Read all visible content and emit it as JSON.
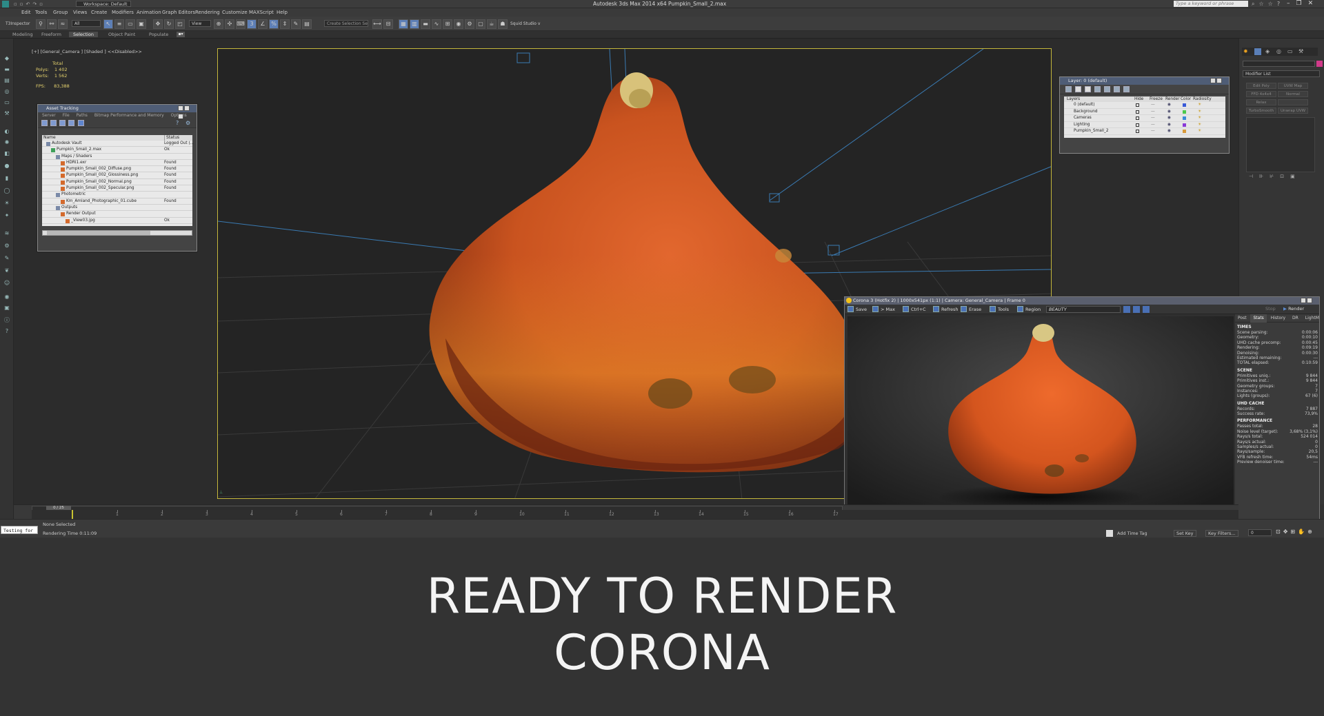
{
  "app": {
    "title": "Autodesk 3ds Max  2014 x64    Pumpkin_Small_2.max",
    "workspace": "Workspace: Default",
    "search_placeholder": "Type a keyword or phrase"
  },
  "menu": [
    "Edit",
    "Tools",
    "Group",
    "Views",
    "Create",
    "Modifiers",
    "Animation",
    "Graph Editors",
    "Rendering",
    "Customize",
    "MAXScript",
    "Help"
  ],
  "toolbar": {
    "left_label": "T3Inspector",
    "filter_value": "All",
    "view_value": "View",
    "selection_set": "Create Selection Se",
    "squid": "Squid Studio v"
  },
  "ribbon": {
    "tabs": [
      "Modeling",
      "Freeform",
      "Selection",
      "Object Paint",
      "Populate"
    ]
  },
  "viewport": {
    "label": "[+] [General_Camera ] [Shaded ] <<Disabled>>",
    "stats": {
      "total": "Total",
      "polys_label": "Polys:",
      "polys": "1 402",
      "verts_label": "Verts:",
      "verts": "1 562",
      "fps_label": "FPS:",
      "fps": "83,388"
    }
  },
  "asset_tracking": {
    "title": "Asset Tracking",
    "menu": [
      "Server",
      "File",
      "Paths",
      "Bitmap Performance and Memory",
      "Options"
    ],
    "headers": [
      "Name",
      "Status"
    ],
    "rows": [
      {
        "name": "Autodesk Vault",
        "status": "Logged Out (...",
        "indent": 0
      },
      {
        "name": "Pumpkin_Small_2.max",
        "status": "Ok",
        "indent": 1
      },
      {
        "name": "Maps / Shaders",
        "status": "",
        "indent": 2
      },
      {
        "name": "HDRI1.exr",
        "status": "Found",
        "indent": 3
      },
      {
        "name": "Pumpkin_Small_002_Diffuse.png",
        "status": "Found",
        "indent": 3
      },
      {
        "name": "Pumpkin_Small_002_Glossiness.png",
        "status": "Found",
        "indent": 3
      },
      {
        "name": "Pumpkin_Small_002_Normal.png",
        "status": "Found",
        "indent": 3
      },
      {
        "name": "Pumpkin_Small_002_Specular.png",
        "status": "Found",
        "indent": 3
      },
      {
        "name": "Photometric",
        "status": "",
        "indent": 2
      },
      {
        "name": "Km_Amland_Photographic_01.cube",
        "status": "Found",
        "indent": 3
      },
      {
        "name": "Outputs",
        "status": "",
        "indent": 2
      },
      {
        "name": "Render Output",
        "status": "",
        "indent": 3
      },
      {
        "name": "_View03.jpg",
        "status": "Ok",
        "indent": 4
      }
    ]
  },
  "layers": {
    "title": "Layer: 0 (default)",
    "headers": [
      "Layers",
      "Hide",
      "Freeze",
      "Render",
      "Color",
      "Radiosity"
    ],
    "rows": [
      {
        "name": "0 (default)",
        "color": "#3a5ad8"
      },
      {
        "name": "Background",
        "color": "#4cc94c"
      },
      {
        "name": "Cameras",
        "color": "#3a8ad8"
      },
      {
        "name": "Lighting",
        "color": "#8a3ad8"
      },
      {
        "name": "Pumpkin_Small_2",
        "color": "#d89a3a"
      }
    ]
  },
  "command_panel": {
    "modifier_list": "Modifier List",
    "buttons": [
      "Edit Poly",
      "UVW Map",
      "FFD 4x4x4",
      "Normal",
      "Relax",
      "",
      "TurboSmooth",
      "Unwrap UVW"
    ]
  },
  "corona": {
    "title": "Corona 3 (Hotfix 2) | 1000x541px (1:1) | Camera: General_Camera | Frame 0",
    "toolbar": [
      "Save",
      "> Max",
      "Ctrl+C",
      "Refresh",
      "Erase",
      "Tools",
      "Region"
    ],
    "pass": "BEAUTY",
    "stop": "Stop",
    "render": "Render",
    "tabs": [
      "Post",
      "Stats",
      "History",
      "DR",
      "LightMix"
    ],
    "sections": [
      {
        "title": "TIMES",
        "rows": [
          [
            "Scene parsing:",
            "0:00:06"
          ],
          [
            "Geometry:",
            "0:00:10"
          ],
          [
            "UHD cache precomp:",
            "0:00:45"
          ],
          [
            "Rendering:",
            "0:09:19"
          ],
          [
            "Denoising:",
            "0:00:30"
          ],
          [
            "Estimated remaining:",
            "---"
          ],
          [
            "TOTAL elapsed:",
            "0:10:59"
          ]
        ]
      },
      {
        "title": "SCENE",
        "rows": [
          [
            "Primitives uniq.:",
            "9 844"
          ],
          [
            "Primitives inst.:",
            "9 844"
          ],
          [
            "Geometry groups:",
            "7"
          ],
          [
            "Instances:",
            "7"
          ],
          [
            "Lights (groups):",
            "67 (6)"
          ]
        ]
      },
      {
        "title": "UHD CACHE",
        "rows": [
          [
            "Records:",
            "7 887"
          ],
          [
            "Success rate:",
            "73,9%"
          ]
        ]
      },
      {
        "title": "PERFORMANCE",
        "rows": [
          [
            "Passes total:",
            "28"
          ],
          [
            "Noise level (target):",
            "3,68% (3,1%)"
          ],
          [
            "Rays/s total:",
            "524 014"
          ],
          [
            "Rays/s actual:",
            "0"
          ],
          [
            "Samples/s actual:",
            "0"
          ],
          [
            "Rays/sample:",
            "20,5"
          ],
          [
            "VFB refresh time:",
            "54ms"
          ],
          [
            "Preview denoiser time:",
            "---"
          ]
        ]
      }
    ]
  },
  "timeline": {
    "frame": "0 / 25",
    "ticks": [
      "1",
      "2",
      "3",
      "4",
      "5",
      "6",
      "7",
      "8",
      "9",
      "10",
      "11",
      "12",
      "13",
      "14",
      "15",
      "16",
      "17"
    ]
  },
  "status": {
    "selection": "None Selected",
    "render_time": "Rendering Time  0:11:09",
    "maxscript": "Testing for",
    "add_time_tag": "Add Time Tag",
    "set_key": "Set Key",
    "key_filters": "Key Filters...",
    "frame_value": "0"
  },
  "headline": {
    "line1": "READY TO RENDER",
    "line2": "CORONA"
  }
}
